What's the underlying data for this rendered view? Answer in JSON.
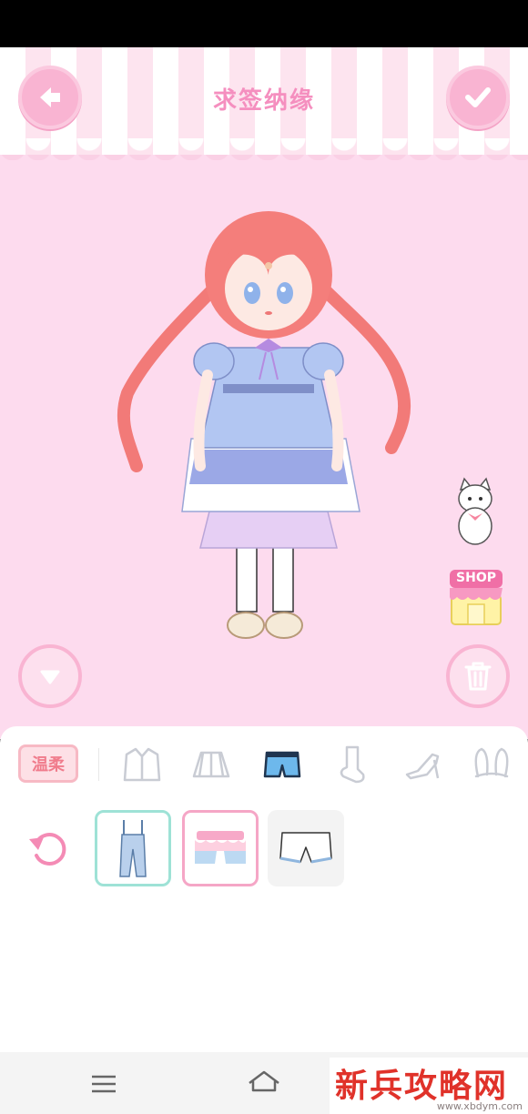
{
  "header": {
    "title": "求签纳缘"
  },
  "category_bar": {
    "style_tag": "温柔",
    "categories": [
      {
        "name": "coat",
        "selected": false
      },
      {
        "name": "skirt",
        "selected": false
      },
      {
        "name": "shorts",
        "selected": true
      },
      {
        "name": "socks",
        "selected": false
      },
      {
        "name": "shoes",
        "selected": false
      },
      {
        "name": "bunny-ears",
        "selected": false
      }
    ]
  },
  "items": [
    {
      "name": "denim-overalls",
      "state": "selected-teal"
    },
    {
      "name": "pink-ruffle-shorts",
      "state": "selected-pink"
    },
    {
      "name": "white-bloomers",
      "state": "normal"
    }
  ],
  "shop": {
    "label": "SHOP"
  },
  "watermark": {
    "main": "新兵攻略网",
    "url": "www.xbdym.com"
  },
  "colors": {
    "accent": "#f9b4d2",
    "background": "#fddbee",
    "title": "#f58fbf"
  }
}
